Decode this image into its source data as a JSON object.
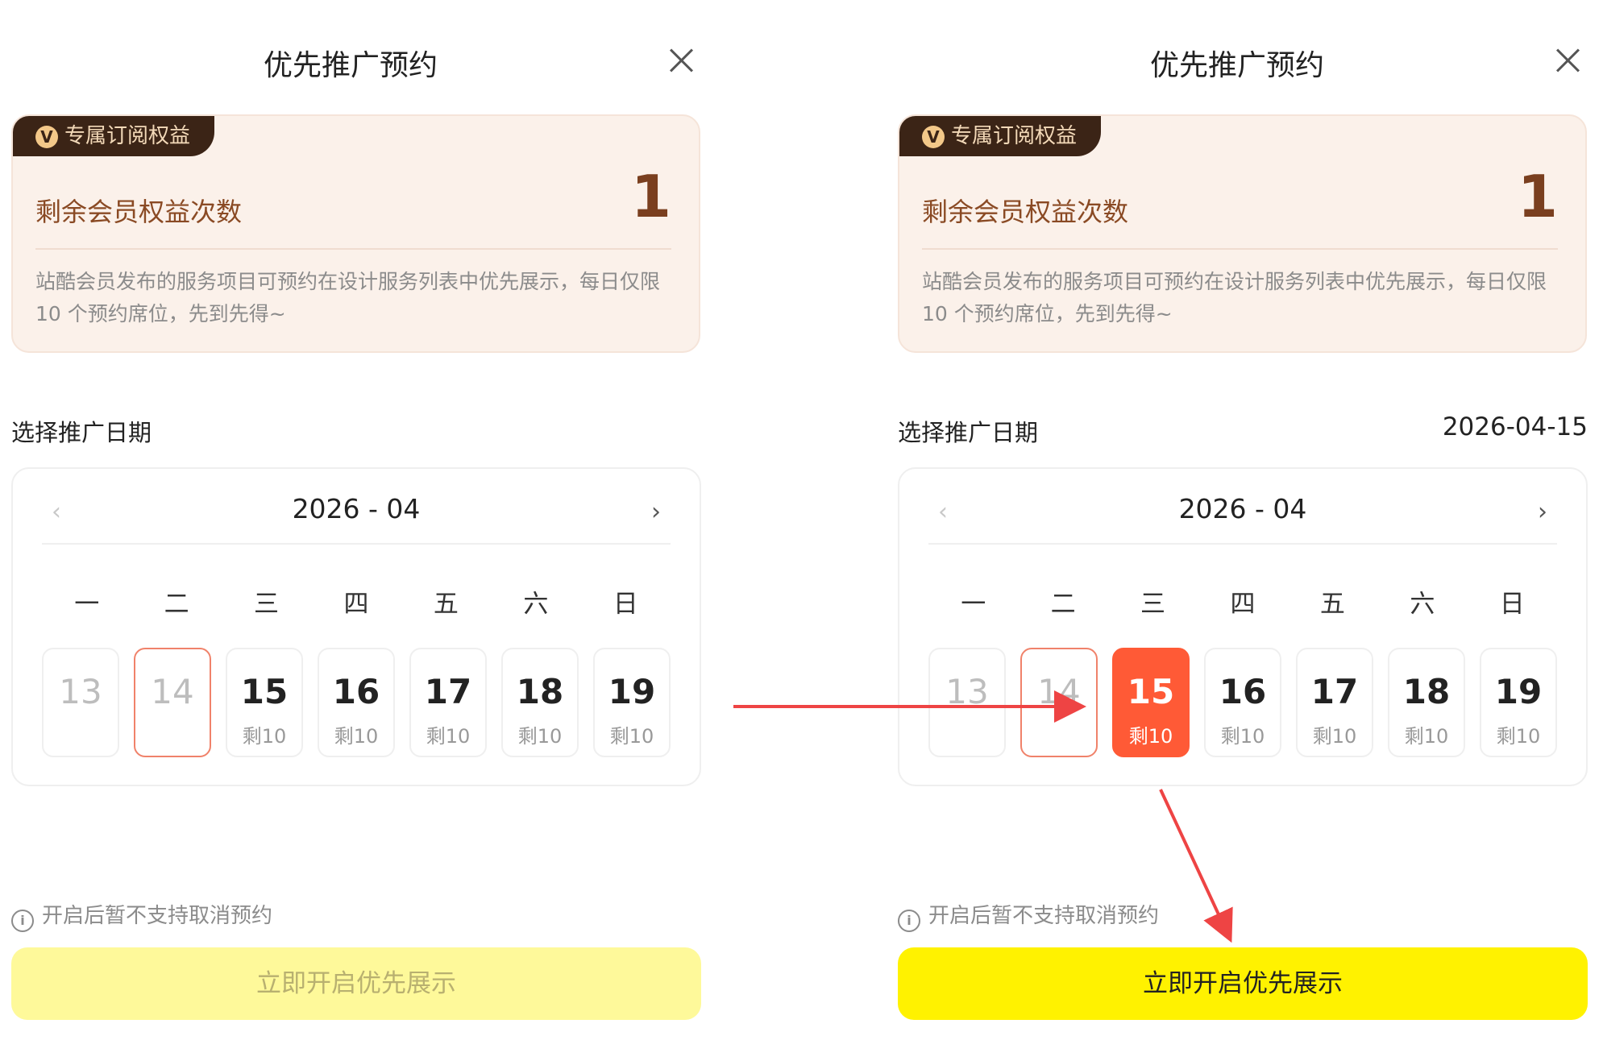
{
  "left_panel": {
    "title": "优先推广预约",
    "badge": {
      "icon_letter": "V",
      "label": "专属订阅权益"
    },
    "remaining": {
      "label": "剩余会员权益次数",
      "count": "1"
    },
    "description": "站酷会员发布的服务项目可预约在设计服务列表中优先展示，每日仅限 10 个预约席位，先到先得~",
    "section_label": "选择推广日期",
    "selected_date": "",
    "calendar": {
      "prev_icon": "‹",
      "next_icon": "›",
      "month": "2026 - 04",
      "weekdays": [
        "一",
        "二",
        "三",
        "四",
        "五",
        "六",
        "日"
      ],
      "days": [
        {
          "num": "13",
          "left": "",
          "state": "past"
        },
        {
          "num": "14",
          "left": "",
          "state": "today"
        },
        {
          "num": "15",
          "left": "剩10",
          "state": "normal"
        },
        {
          "num": "16",
          "left": "剩10",
          "state": "normal"
        },
        {
          "num": "17",
          "left": "剩10",
          "state": "normal"
        },
        {
          "num": "18",
          "left": "剩10",
          "state": "normal"
        },
        {
          "num": "19",
          "left": "剩10",
          "state": "normal"
        }
      ]
    },
    "note": "开启后暂不支持取消预约",
    "button": {
      "label": "立即开启优先展示",
      "state": "disabled"
    }
  },
  "right_panel": {
    "title": "优先推广预约",
    "badge": {
      "icon_letter": "V",
      "label": "专属订阅权益"
    },
    "remaining": {
      "label": "剩余会员权益次数",
      "count": "1"
    },
    "description": "站酷会员发布的服务项目可预约在设计服务列表中优先展示，每日仅限 10 个预约席位，先到先得~",
    "section_label": "选择推广日期",
    "selected_date": "2026-04-15",
    "calendar": {
      "prev_icon": "‹",
      "next_icon": "›",
      "month": "2026 - 04",
      "weekdays": [
        "一",
        "二",
        "三",
        "四",
        "五",
        "六",
        "日"
      ],
      "days": [
        {
          "num": "13",
          "left": "",
          "state": "past"
        },
        {
          "num": "14",
          "left": "",
          "state": "today"
        },
        {
          "num": "15",
          "left": "剩10",
          "state": "selected"
        },
        {
          "num": "16",
          "left": "剩10",
          "state": "normal"
        },
        {
          "num": "17",
          "left": "剩10",
          "state": "normal"
        },
        {
          "num": "18",
          "left": "剩10",
          "state": "normal"
        },
        {
          "num": "19",
          "left": "剩10",
          "state": "normal"
        }
      ]
    },
    "note": "开启后暂不支持取消预约",
    "button": {
      "label": "立即开启优先展示",
      "state": "enabled"
    }
  },
  "colors": {
    "accent_selected": "#ff5a36",
    "button_enabled": "#fff200",
    "button_disabled": "#fef99a",
    "annotation_arrow": "#ee4444",
    "badge_bg": "#3b2416"
  }
}
